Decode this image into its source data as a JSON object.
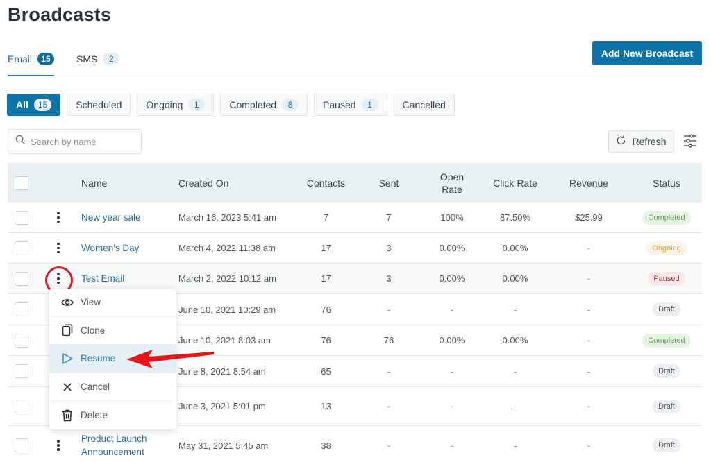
{
  "header": {
    "title": "Broadcasts"
  },
  "channel_tabs": [
    {
      "label": "Email",
      "count": "15",
      "active": true
    },
    {
      "label": "SMS",
      "count": "2",
      "active": false
    }
  ],
  "add_button_label": "Add New Broadcast",
  "filters": [
    {
      "label": "All",
      "count": "15",
      "active": true
    },
    {
      "label": "Scheduled",
      "count": null
    },
    {
      "label": "Ongoing",
      "count": "1"
    },
    {
      "label": "Completed",
      "count": "8"
    },
    {
      "label": "Paused",
      "count": "1"
    },
    {
      "label": "Cancelled",
      "count": null
    }
  ],
  "search": {
    "placeholder": "Search by name",
    "value": ""
  },
  "refresh_label": "Refresh",
  "table": {
    "columns": {
      "name": "Name",
      "created": "Created On",
      "contacts": "Contacts",
      "sent": "Sent",
      "open_rate": "Open Rate",
      "click_rate": "Click Rate",
      "revenue": "Revenue",
      "status": "Status"
    },
    "rows": [
      {
        "name": "New year sale",
        "created": "March 16, 2023 5:41 am",
        "contacts": "7",
        "sent": "7",
        "open_rate": "100%",
        "click_rate": "87.50%",
        "revenue": "$25.99",
        "status": "Completed"
      },
      {
        "name": "Women's Day",
        "created": "March 4, 2022 11:38 am",
        "contacts": "17",
        "sent": "3",
        "open_rate": "0.00%",
        "click_rate": "0.00%",
        "revenue": "-",
        "status": "Ongoing"
      },
      {
        "name": "Test Email",
        "created": "March 2, 2022 10:12 am",
        "contacts": "17",
        "sent": "3",
        "open_rate": "0.00%",
        "click_rate": "0.00%",
        "revenue": "-",
        "status": "Paused"
      },
      {
        "name": "",
        "created": "June 10, 2021 10:29 am",
        "contacts": "76",
        "sent": "-",
        "open_rate": "-",
        "click_rate": "-",
        "revenue": "-",
        "status": "Draft"
      },
      {
        "name": "",
        "created": "June 10, 2021 8:03 am",
        "contacts": "76",
        "sent": "76",
        "open_rate": "0.00%",
        "click_rate": "0.00%",
        "revenue": "-",
        "status": "Completed"
      },
      {
        "name": "",
        "created": "June 8, 2021 8:54 am",
        "contacts": "65",
        "sent": "-",
        "open_rate": "-",
        "click_rate": "-",
        "revenue": "-",
        "status": "Draft"
      },
      {
        "name": "",
        "created": "June 3, 2021 5:01 pm",
        "contacts": "13",
        "sent": "-",
        "open_rate": "-",
        "click_rate": "-",
        "revenue": "-",
        "status": "Draft"
      },
      {
        "name": "Product Launch Announcement",
        "created": "May 31, 2021 5:45 am",
        "contacts": "38",
        "sent": "-",
        "open_rate": "-",
        "click_rate": "-",
        "revenue": "-",
        "status": "Draft"
      }
    ]
  },
  "action_menu": {
    "items": [
      {
        "label": "View",
        "icon": "eye-icon"
      },
      {
        "label": "Clone",
        "icon": "copy-icon"
      },
      {
        "label": "Resume",
        "icon": "play-icon",
        "highlighted": true
      },
      {
        "label": "Cancel",
        "icon": "close-icon"
      },
      {
        "label": "Delete",
        "icon": "trash-icon"
      }
    ]
  },
  "colors": {
    "primary": "#0e73a6",
    "link": "#2a6f97",
    "annotation": "#e8141b"
  }
}
